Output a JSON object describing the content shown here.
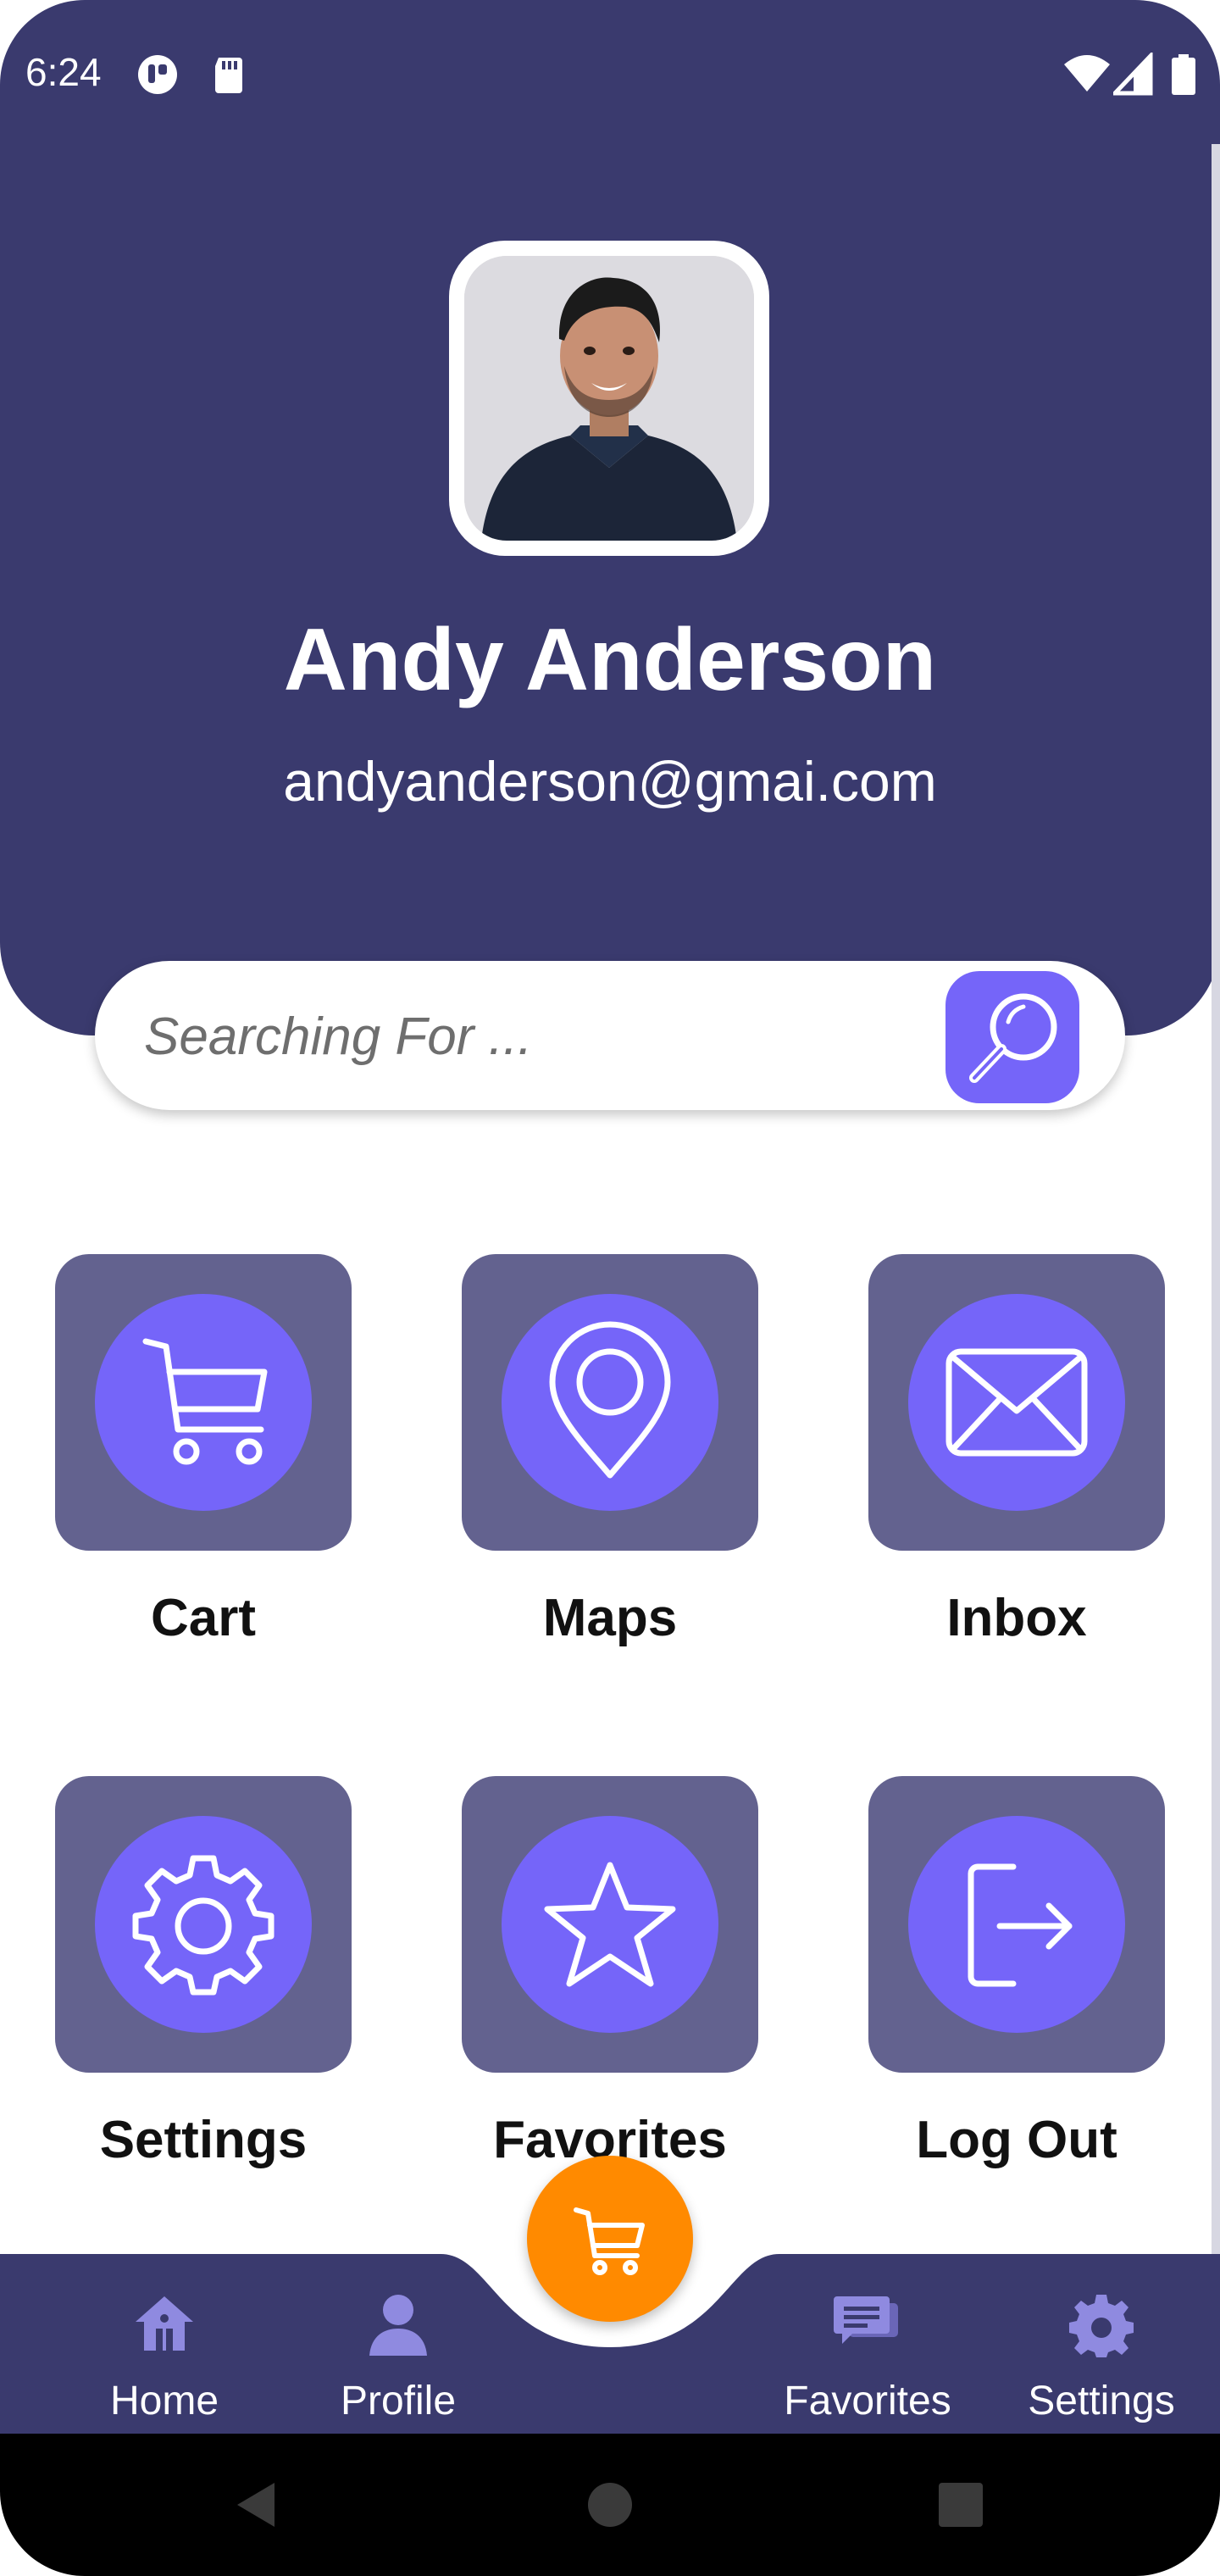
{
  "status_bar": {
    "time": "6:24",
    "icons": [
      "notification-icon",
      "sd-card-icon",
      "wifi-icon",
      "signal-icon",
      "battery-icon"
    ]
  },
  "profile": {
    "name": "Andy Anderson",
    "email": "andyanderson@gmai.com"
  },
  "search": {
    "placeholder": "Searching For ...",
    "icon": "search-icon"
  },
  "grid": {
    "items": [
      {
        "label": "Cart",
        "icon": "cart-icon"
      },
      {
        "label": "Maps",
        "icon": "map-pin-icon"
      },
      {
        "label": "Inbox",
        "icon": "mail-icon"
      },
      {
        "label": "Settings",
        "icon": "gear-icon"
      },
      {
        "label": "Favorites",
        "icon": "star-icon"
      },
      {
        "label": "Log Out",
        "icon": "logout-icon"
      }
    ]
  },
  "bottom_nav": {
    "items": [
      {
        "label": "Home",
        "icon": "home-icon"
      },
      {
        "label": "Profile",
        "icon": "user-icon"
      },
      {
        "label": "Favorites",
        "icon": "chat-icon"
      },
      {
        "label": "Settings",
        "icon": "gear-icon"
      }
    ],
    "fab_icon": "cart-icon"
  },
  "colors": {
    "header_bg": "#3a3a6e",
    "accent": "#7565f9",
    "tile_bg": "#63628f",
    "fab": "#ff8a00",
    "nav_icon": "#8f8ae0"
  }
}
